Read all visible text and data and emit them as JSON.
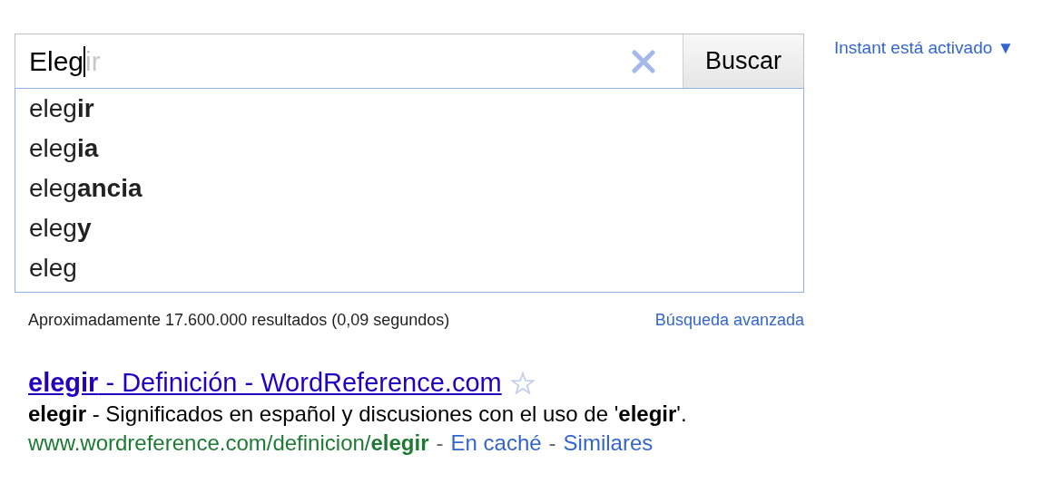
{
  "search": {
    "value": "Eleg",
    "completion": "ir",
    "button": "Buscar"
  },
  "instant": {
    "label": "Instant está activado",
    "caret": "▼"
  },
  "suggestions": [
    "eleg**ir**",
    "eleg**ia**",
    "eleg**ancia**",
    "eleg**y**",
    "eleg"
  ],
  "stats": "Aproximadamente 17.600.000 resultados (0,09 segundos)",
  "advanced": "Búsqueda avanzada",
  "results": [
    {
      "title": "**elegir** - Definición - WordReference.com",
      "snippet": "**elegir** - Significados en español y discusiones con el uso de '**elegir**'.",
      "url": "www.wordreference.com/definicion/**elegir**",
      "separator": "-",
      "links": [
        "En caché",
        "Similares"
      ]
    }
  ]
}
